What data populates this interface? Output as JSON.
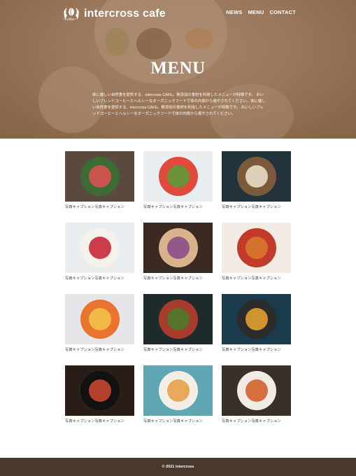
{
  "brand": {
    "name": "intercross cafe",
    "sub": "~Coffee~"
  },
  "nav": {
    "items": [
      "NEWS",
      "MENU",
      "CONTACT"
    ]
  },
  "hero": {
    "title": "MENU",
    "description": "体に優しい自然食を提供する、intercross CAFE。無添加の食材を利用したメニューが特徴です。 おいしいブレンドコーヒーとヘルシーなオーガニックフードで体の内側から癒やされてください。体に優しい自然食を提供する、intercross CAFE。無添加の食材を利用したメニューが特徴です。 おいしいブレンドコーヒーとヘルシーなオーガニックフードで体の内側から癒やされてください。"
  },
  "menu": {
    "items": [
      {
        "caption": "写真キャプション写真キャプション",
        "bg": "#5a4a40",
        "a": "#d9534f",
        "b": "#3d6b35"
      },
      {
        "caption": "写真キャプション写真キャプション",
        "bg": "#e8eef2",
        "a": "#5f9a3a",
        "b": "#e24a3b"
      },
      {
        "caption": "写真キャプション写真キャプション",
        "bg": "#24323c",
        "a": "#e8dcc6",
        "b": "#7a5a3a"
      },
      {
        "caption": "写真キャプション写真キャプション",
        "bg": "#e9eef1",
        "a": "#c8283a",
        "b": "#f5f2ea"
      },
      {
        "caption": "写真キャプション写真キャプション",
        "bg": "#3b2a22",
        "a": "#8b4e8c",
        "b": "#d9b38c"
      },
      {
        "caption": "写真キャプション写真キャプション",
        "bg": "#f2ece4",
        "a": "#d7772e",
        "b": "#c23a2a"
      },
      {
        "caption": "写真キャプション写真キャプション",
        "bg": "#e7e4ea",
        "a": "#f1c048",
        "b": "#e8742e"
      },
      {
        "caption": "写真キャプション写真キャプション",
        "bg": "#1f2a2c",
        "a": "#4e7a2a",
        "b": "#a73b2c"
      },
      {
        "caption": "写真キャプション写真キャプション",
        "bg": "#1b3a4c",
        "a": "#e0a030",
        "b": "#2b2b2b"
      },
      {
        "caption": "写真キャプション写真キャプション",
        "bg": "#2a1e18",
        "a": "#c7452e",
        "b": "#111111"
      },
      {
        "caption": "写真キャプション写真キャプション",
        "bg": "#5fa7b5",
        "a": "#e6a04a",
        "b": "#f3efe6"
      },
      {
        "caption": "写真キャプション写真キャプション",
        "bg": "#3a302a",
        "a": "#d2622a",
        "b": "#f1ece5"
      }
    ]
  },
  "footer": {
    "copyright": "© 2021 intercross"
  }
}
